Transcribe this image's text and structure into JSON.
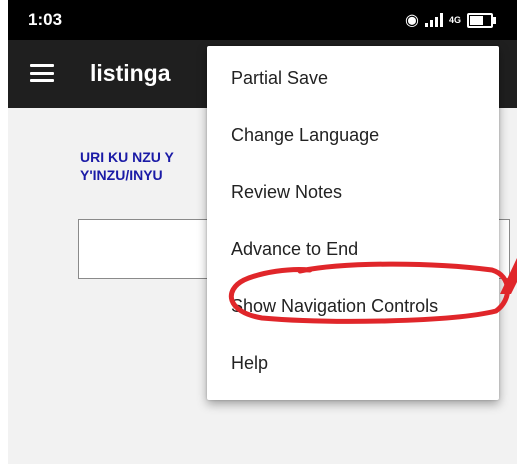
{
  "status_bar": {
    "time": "1:03",
    "network": "4G",
    "icons": [
      "hotspot-icon",
      "signal-icon",
      "battery-icon"
    ]
  },
  "app_bar": {
    "title": "listinga",
    "menu_icon": "hamburger-menu-icon"
  },
  "form": {
    "question_line1": "URI KU NZU Y",
    "question_line2": "Y'INZU/INYU"
  },
  "overflow_menu": {
    "items": [
      {
        "label": "Partial Save"
      },
      {
        "label": "Change Language"
      },
      {
        "label": "Review Notes"
      },
      {
        "label": "Advance to End"
      },
      {
        "label": "Show Navigation Controls"
      },
      {
        "label": "Help"
      }
    ]
  },
  "annotation": {
    "circle_color": "#e0262a",
    "circled_item": "Show Navigation Controls"
  }
}
